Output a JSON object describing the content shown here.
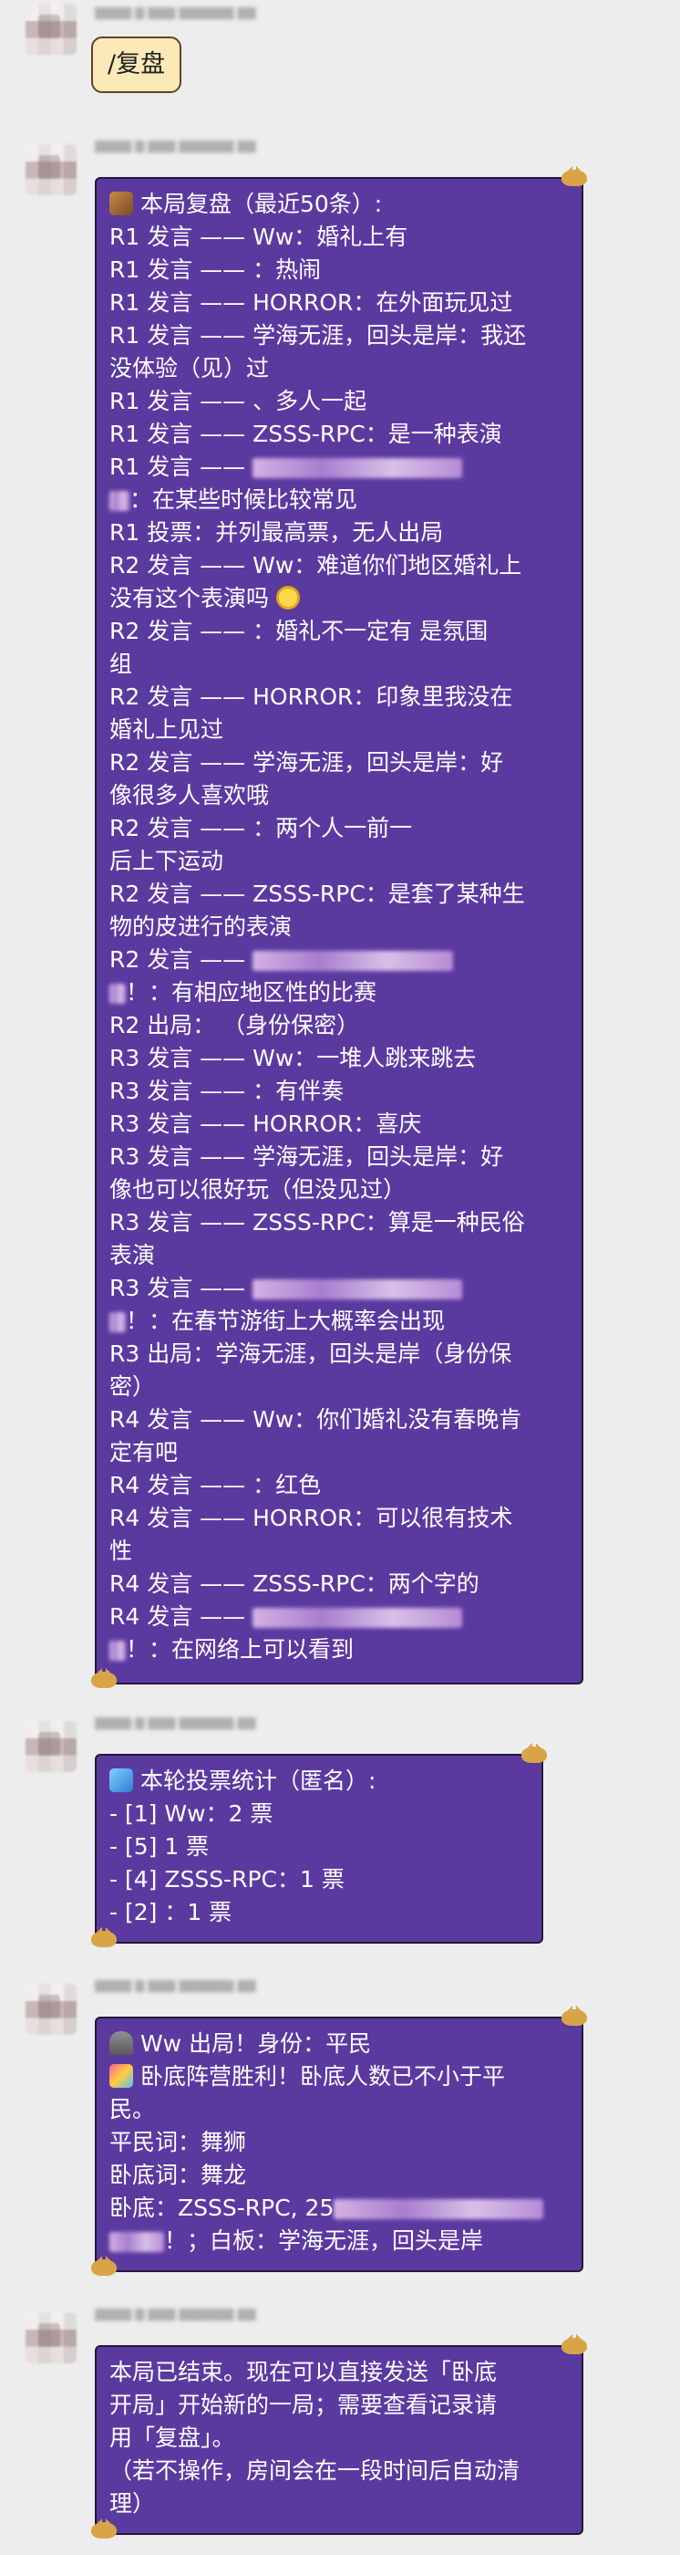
{
  "messages": [
    {
      "type": "command",
      "text": "/复盘"
    },
    {
      "type": "review",
      "lines": [
        "本局复盘（最近50条）:",
        "R1 发言 —— Ww：婚礼上有",
        "R1 发言 —— ：热闹",
        "R1 发言 —— HORROR：在外面玩见过",
        "R1 发言 —— 学海无涯，回头是岸：我还",
        "没体验（见）过",
        "R1 发言 ——        、多人一起",
        "R1 发言 —— ZSSS-RPC：是一种表演",
        "R1 发言 —— ",
        "：在某些时候比较常见",
        "R1 投票：并列最高票，无人出局",
        "R2 发言 —— Ww：难道你们地区婚礼上",
        "没有这个表演吗",
        "R2 发言 —— ：婚礼不一定有  是氛围",
        "组",
        "R2 发言 —— HORROR：印象里我没在",
        "婚礼上见过",
        "R2 发言 —— 学海无涯，回头是岸：好",
        "像很多人喜欢哦",
        "R2 发言 ——          ：两个人一前一",
        "后上下运动",
        "R2 发言 —— ZSSS-RPC：是套了某种生",
        "物的皮进行的表演",
        "R2 发言 —— ",
        "！：有相应地区性的比赛",
        "R2 出局：          （身份保密）",
        "R3 发言 —— Ww：一堆人跳来跳去",
        "R3 发言 —— ：有伴奏",
        "R3 发言 —— HORROR：喜庆",
        "R3 发言 —— 学海无涯，回头是岸：好",
        "像也可以很好玩（但没见过）",
        "R3 发言 —— ZSSS-RPC：算是一种民俗",
        "表演",
        "R3 发言 —— ",
        "！：在春节游街上大概率会出现",
        "R3 出局：学海无涯，回头是岸（身份保",
        "密）",
        "R4 发言 —— Ww：你们婚礼没有春晚肯",
        "定有吧",
        "R4 发言 —— ：红色",
        "R4 发言 —— HORROR：可以很有技术",
        "性",
        "R4 发言 —— ZSSS-RPC：两个字的",
        "R4 发言 —— ",
        "！：在网络上可以看到"
      ]
    },
    {
      "type": "vote",
      "lines": [
        "本轮投票统计（匿名）:",
        "- [1] Ww：2 票",
        "- [5]                                         1 票",
        "- [4] ZSSS-RPC：1 票",
        "- [2] ：1 票"
      ]
    },
    {
      "type": "result",
      "lines": [
        "Ww 出局！身份：平民",
        "卧底阵营胜利！卧底人数已不小于平",
        "民。",
        "平民词：舞狮",
        "卧底词：舞龙",
        "卧底：ZSSS-RPC, 25",
        "！；白板：学海无涯，回头是岸"
      ]
    },
    {
      "type": "end",
      "lines": [
        "本局已结束。现在可以直接发送「卧底",
        "开局」开始新的一局；需要查看记录请",
        "用「复盘」。",
        "（若不操作，房间会在一段时间后自动清",
        "理）"
      ]
    }
  ]
}
